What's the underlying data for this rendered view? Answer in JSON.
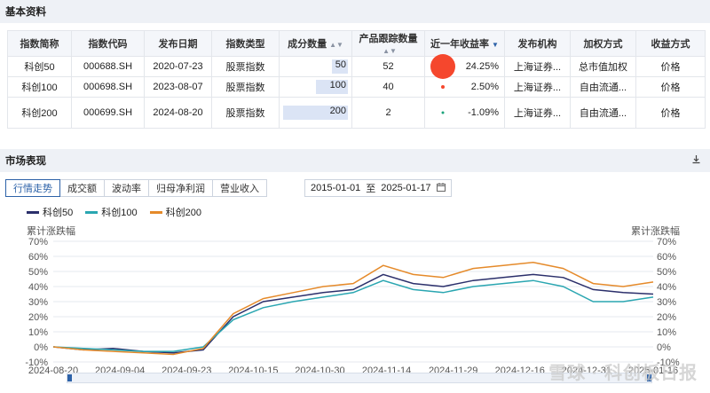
{
  "basic": {
    "title": "基本资料",
    "columns": [
      "指数简称",
      "指数代码",
      "发布日期",
      "指数类型",
      "成分数量",
      "产品跟踪数量",
      "近一年收益率",
      "发布机构",
      "加权方式",
      "收益方式"
    ],
    "rows": [
      {
        "name": "科创50",
        "code": "000688.SH",
        "date": "2020-07-23",
        "type": "股票指数",
        "count": "50",
        "count_ratio": 0.25,
        "tracking": "52",
        "ret": "24.25%",
        "ret_color": "#f5472d",
        "inst": "上海证券...",
        "weight": "总市值加权",
        "method": "价格"
      },
      {
        "name": "科创100",
        "code": "000698.SH",
        "date": "2023-08-07",
        "type": "股票指数",
        "count": "100",
        "count_ratio": 0.5,
        "tracking": "40",
        "ret": "2.50%",
        "ret_color": "#f5472d",
        "inst": "上海证券...",
        "weight": "自由流通...",
        "method": "价格"
      },
      {
        "name": "科创200",
        "code": "000699.SH",
        "date": "2024-08-20",
        "type": "股票指数",
        "count": "200",
        "count_ratio": 1.0,
        "tracking": "2",
        "ret": "-1.09%",
        "ret_color": "#1aa37a",
        "inst": "上海证券...",
        "weight": "自由流通...",
        "method": "价格"
      }
    ]
  },
  "market": {
    "title": "市场表现",
    "tabs": [
      "行情走势",
      "成交额",
      "波动率",
      "归母净利润",
      "营业收入"
    ],
    "date_from": "2015-01-01",
    "date_sep": "至",
    "date_to": "2025-01-17",
    "ylabel_left": "累计涨跌幅",
    "ylabel_right": "累计涨跌幅"
  },
  "watermark": "雪球 · 科创板日报",
  "icons": {
    "download": "download-icon",
    "calendar": "calendar-icon",
    "sort": "sort-icon"
  },
  "chart_data": {
    "type": "line",
    "x": [
      "2024-08-20",
      "2024-08-27",
      "2024-09-04",
      "2024-09-11",
      "2024-09-18",
      "2024-09-23",
      "2024-09-27",
      "2024-10-08",
      "2024-10-15",
      "2024-10-22",
      "2024-10-30",
      "2024-11-07",
      "2024-11-14",
      "2024-11-21",
      "2024-11-29",
      "2024-12-06",
      "2024-12-16",
      "2024-12-24",
      "2024-12-31",
      "2025-01-08",
      "2025-01-16"
    ],
    "xticks": [
      "2024-08-20",
      "2024-09-04",
      "2024-09-23",
      "2024-10-15",
      "2024-10-30",
      "2024-11-14",
      "2024-11-29",
      "2024-12-16",
      "2024-12-31",
      "2025-01-16"
    ],
    "series": [
      {
        "name": "科创50",
        "color": "#2b2f6b",
        "values": [
          0,
          -2,
          -1,
          -3,
          -4,
          -2,
          20,
          30,
          33,
          36,
          38,
          48,
          42,
          40,
          44,
          46,
          48,
          46,
          38,
          36,
          35
        ]
      },
      {
        "name": "科创100",
        "color": "#2aa6b1",
        "values": [
          0,
          -1,
          -2,
          -3,
          -3,
          0,
          18,
          26,
          30,
          33,
          36,
          44,
          38,
          36,
          40,
          42,
          44,
          40,
          30,
          30,
          33
        ]
      },
      {
        "name": "科创200",
        "color": "#e58a2a",
        "values": [
          0,
          -2,
          -3,
          -4,
          -5,
          -1,
          22,
          32,
          36,
          40,
          42,
          54,
          48,
          46,
          52,
          54,
          56,
          52,
          42,
          40,
          43
        ]
      }
    ],
    "ylim": [
      -10,
      70
    ],
    "yticks": [
      "-10%",
      "0%",
      "10%",
      "20%",
      "30%",
      "40%",
      "50%",
      "60%",
      "70%"
    ],
    "grid": true,
    "legend": "top-left"
  }
}
